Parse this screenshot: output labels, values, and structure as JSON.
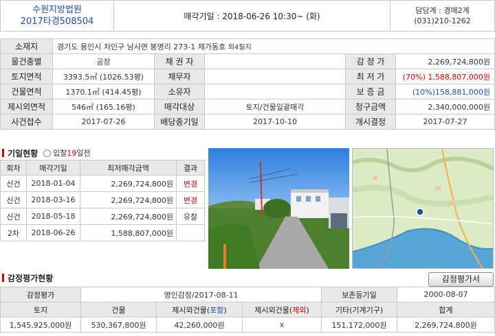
{
  "header": {
    "court": "수원지방법원",
    "case_no": "2017타경508504",
    "sale_date_label": "매각기일 : 2018-06-26  10:30~ (화)",
    "dept": "담당계 : 경매2계",
    "phone": "(031)210-1262"
  },
  "info": {
    "location_label": "소재지",
    "location_value": "경기도 용인시 처인구 남사면 봉명리 273-1 제가동호",
    "location_extra": "외4필지",
    "type_label": "물건종별",
    "type_value": "공장",
    "creditor_label": "채 권 자",
    "creditor_value": "",
    "appraisal_label": "감 정 가",
    "appraisal_value": "2,269,724,800원",
    "land_label": "토지면적",
    "land_value": "3393.5㎡ (1026.53평)",
    "debtor_label": "채무자",
    "debtor_value": "",
    "min_label": "최 저 가",
    "min_value": "(70%) 1,588,807,000원",
    "bldg_label": "건물면적",
    "bldg_value": "1370.1㎡ (414.45평)",
    "owner_label": "소유자",
    "owner_value": "",
    "deposit_label": "보 증 금",
    "deposit_value": "(10%)158,881,000원",
    "excl_label": "제시외면적",
    "excl_value": "546㎡ (165.16평)",
    "target_label": "매각대상",
    "target_value": "토지/건물일괄매각",
    "claim_label": "청구금액",
    "claim_value": "2,340,000,000원",
    "filed_label": "사건접수",
    "filed_value": "2017-07-26",
    "dist_label": "배당종기일",
    "dist_value": "2017-10-10",
    "start_label": "개시결정",
    "start_value": "2017-07-27"
  },
  "history": {
    "title": "기일현황",
    "sub_prefix": "입찰",
    "sub_days": "19",
    "sub_suffix": "일전",
    "columns": [
      "회차",
      "매각기일",
      "최저매각금액",
      "결과"
    ],
    "rows": [
      {
        "round": "신건",
        "date": "2018-01-04",
        "amount": "2,269,724,800원",
        "result": "변경",
        "result_color": "#d00000"
      },
      {
        "round": "신건",
        "date": "2018-03-16",
        "amount": "2,269,724,800원",
        "result": "변경",
        "result_color": "#d00000"
      },
      {
        "round": "신건",
        "date": "2018-05-18",
        "amount": "2,269,724,800원",
        "result": "유찰",
        "result_color": "#333333"
      },
      {
        "round": "2차",
        "date": "2018-06-26",
        "amount": "1,588,807,000원",
        "result": "",
        "result_color": "#333333"
      }
    ]
  },
  "appraisal": {
    "title": "감정평가현황",
    "button": "감정평가서",
    "label": "감정평가",
    "agency": "명인감정/2017-08-11",
    "preserve_label": "보존등기일",
    "preserve_value": "2000-08-07",
    "col_land": "토지",
    "col_bldg": "건물",
    "col_incl_pre": "제시외건물(",
    "col_incl_mid": "포함",
    "col_incl_post": ")",
    "col_excl_pre": "제시외건물(",
    "col_excl_mid": "제외",
    "col_excl_post": ")",
    "col_other": "기타(기계기구)",
    "col_total": "합계",
    "land": "1,545,925,000원",
    "bldg": "530,367,800원",
    "incl": "42,260,000원",
    "excl": "x",
    "other": "151,172,000원",
    "total": "2,269,724,800원"
  },
  "colors": {
    "label_bg": "#e8e8e8",
    "blue": "#1e4fa8",
    "red": "#d00000"
  }
}
